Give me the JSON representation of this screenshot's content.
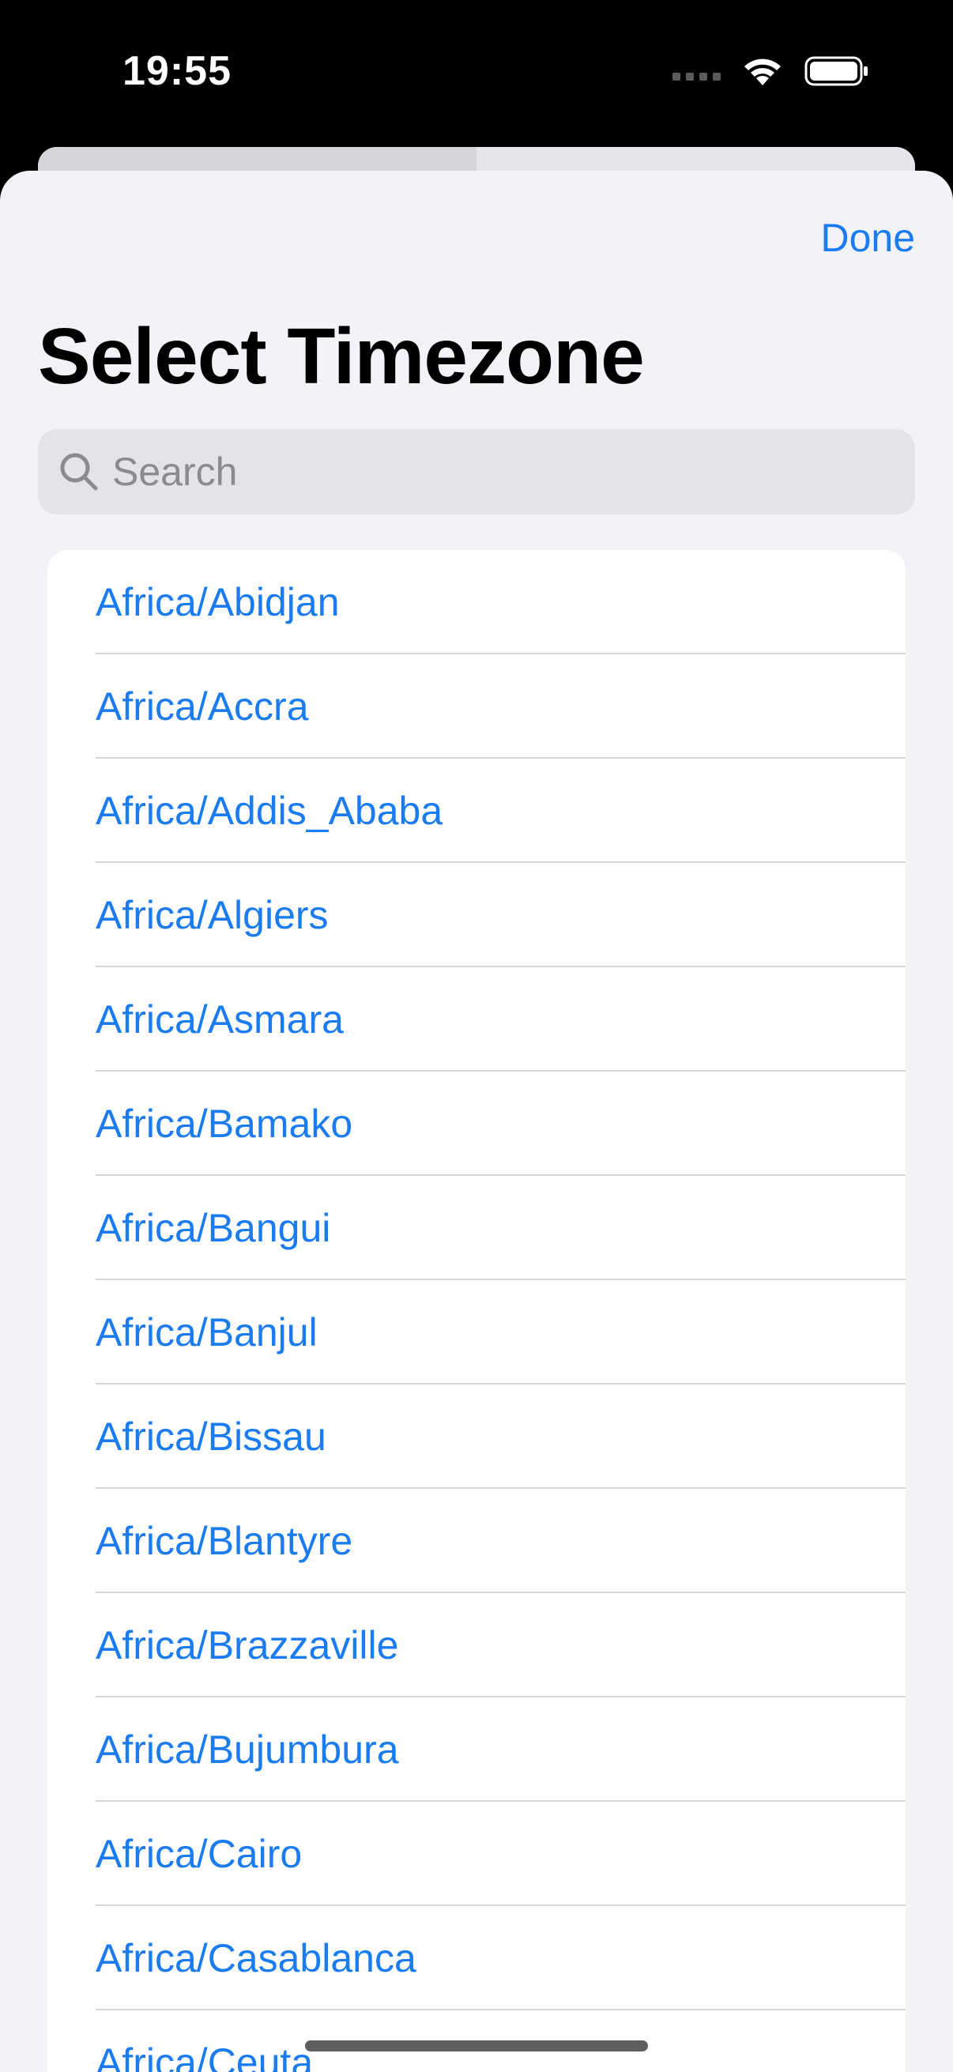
{
  "status_bar": {
    "time": "19:55",
    "icons": [
      "cellular-signal-icon",
      "wifi-icon",
      "battery-icon"
    ]
  },
  "header": {
    "done_label": "Done",
    "title": "Select Timezone"
  },
  "search": {
    "placeholder": "Search",
    "value": ""
  },
  "timezones": [
    "Africa/Abidjan",
    "Africa/Accra",
    "Africa/Addis_Ababa",
    "Africa/Algiers",
    "Africa/Asmara",
    "Africa/Bamako",
    "Africa/Bangui",
    "Africa/Banjul",
    "Africa/Bissau",
    "Africa/Blantyre",
    "Africa/Brazzaville",
    "Africa/Bujumbura",
    "Africa/Cairo",
    "Africa/Casablanca",
    "Africa/Ceuta"
  ],
  "colors": {
    "accent": "#1a7cf0",
    "sheet_background": "#f2f2f7",
    "list_background": "#ffffff",
    "search_background": "#e3e3e8"
  }
}
